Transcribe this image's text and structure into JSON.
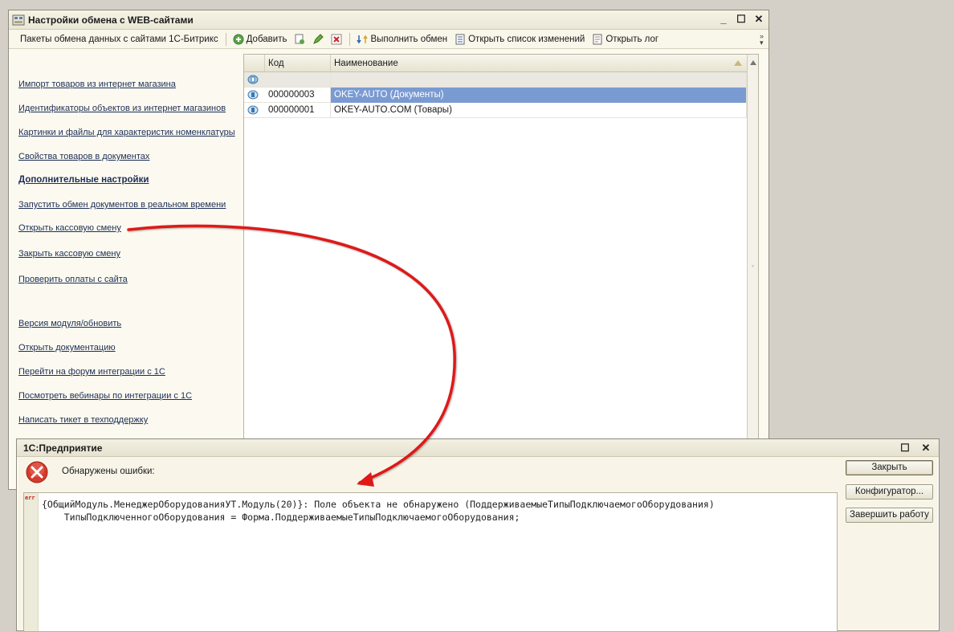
{
  "main_window": {
    "title": "Настройки обмена с WEB-сайтами",
    "win_minimize": "_",
    "win_maximize": "☐",
    "win_close": "✕"
  },
  "toolbar": {
    "packages_label": "Пакеты обмена данных с сайтами 1С-Битрикс",
    "add_label": "Добавить",
    "run_exchange_label": "Выполнить обмен",
    "open_changes_label": "Открыть список изменений",
    "open_log_label": "Открыть лог"
  },
  "links": [
    "Импорт товаров из интернет магазина",
    "Идентификаторы объектов из интернет магазинов",
    "Картинки и файлы для характеристик номенклатуры",
    "Свойства товаров в документах",
    "Дополнительные настройки",
    "Запустить обмен документов в реальном времени",
    "Открыть кассовую смену",
    "Закрыть кассовую смену",
    "Проверить оплаты с сайта",
    "Версия модуля/обновить",
    "Открыть документацию",
    "Перейти на форум интеграции с 1С",
    "Посмотреть вебинары по интеграции с 1С",
    "Написать тикет в техподдержку"
  ],
  "grid": {
    "columns": [
      "Код",
      "Наименование"
    ],
    "rows": [
      {
        "code": "",
        "name": ""
      },
      {
        "code": "000000003",
        "name": "OKEY-AUTO (Документы)"
      },
      {
        "code": "000000001",
        "name": "OKEY-AUTO.COM (Товары)"
      }
    ]
  },
  "dialog": {
    "title": "1С:Предприятие",
    "win_maximize": "☐",
    "win_close": "✕",
    "caption": "Обнаружены ошибки:",
    "error_tag": "err",
    "error_line1": "{ОбщийМодуль.МенеджерОборудованияУТ.Модуль(20)}: Поле объекта не обнаружено (ПоддерживаемыеТипыПодключаемогоОборудования)",
    "error_line2": "    ТипыПодключенногоОборудования = Форма.ПоддерживаемыеТипыПодключаемогоОборудования;",
    "close_button": "Закрыть",
    "configurator_button": "Конфигуратор...",
    "exit_button": "Завершить работу"
  },
  "colors": {
    "selection": "#7a9ad2",
    "annotation_arrow": "#e01818",
    "error_icon": "#d63a2a"
  }
}
